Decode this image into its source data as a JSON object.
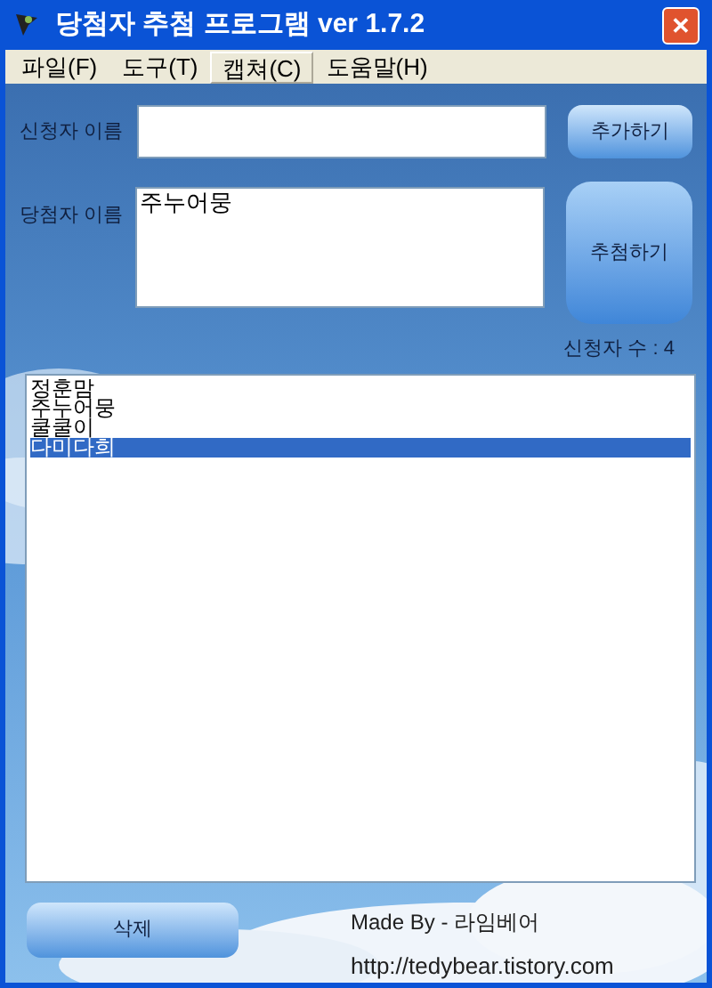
{
  "window": {
    "title": "당첨자 추첨 프로그램 ver 1.7.2",
    "close": "✕"
  },
  "menu": [
    {
      "label": "파일(F)",
      "selected": false
    },
    {
      "label": "도구(T)",
      "selected": false
    },
    {
      "label": "캡쳐(C)",
      "selected": true
    },
    {
      "label": "도움말(H)",
      "selected": false
    }
  ],
  "applicant": {
    "label": "신청자 이름",
    "button": "추가하기"
  },
  "winner": {
    "label": "당첨자 이름",
    "value": "주누어뭉",
    "button": "추첨하기"
  },
  "count": "신청자 수 : 4",
  "list": [
    {
      "name": "정훈맘",
      "selected": false
    },
    {
      "name": "주누어뭉",
      "selected": false
    },
    {
      "name": "쿨쿨이",
      "selected": false
    },
    {
      "name": "다미다희",
      "selected": true
    }
  ],
  "delete_button": "삭제",
  "credit": "Made By - 라임베어",
  "url": "http://tedybear.tistory.com"
}
